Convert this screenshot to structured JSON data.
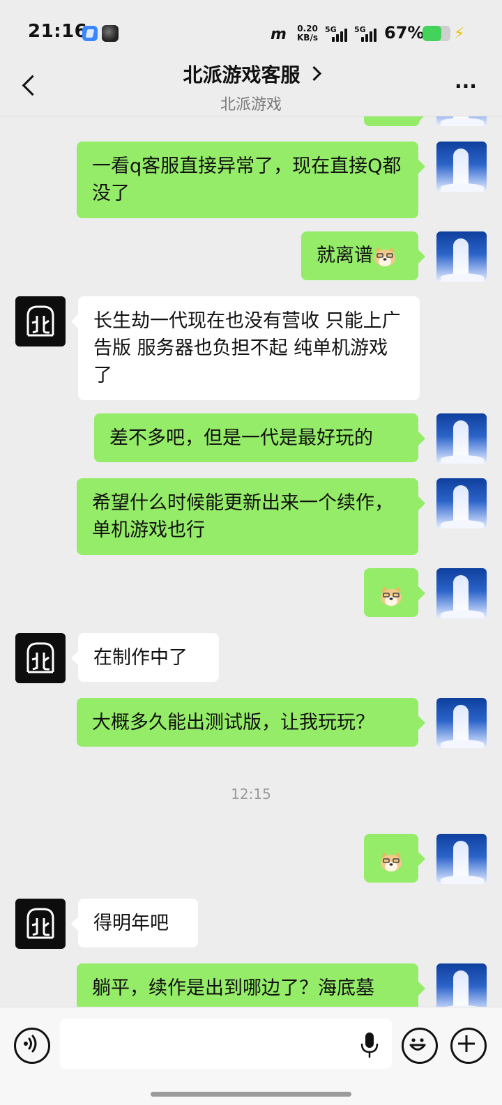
{
  "status_bar": {
    "time": "21:16",
    "net_speed_value": "0.20",
    "net_speed_unit": "KB/s",
    "sim1": "5G",
    "sim2": "5G",
    "battery_percent": "67%",
    "battery_level": 0.67,
    "colors": {
      "battery_fill": "#43d35a",
      "charging_bolt": "#f2c200"
    }
  },
  "header": {
    "title": "北派游戏客服",
    "subtitle": "北派游戏",
    "more_label": "···"
  },
  "chat": {
    "messages": [
      {
        "sender": "me",
        "text": "一看q客服直接异常了，现在直接Q都没了"
      },
      {
        "sender": "me",
        "text": "就离谱",
        "sticker": "doge-sticker"
      },
      {
        "sender": "them",
        "text": "长生劫一代现在也没有营收 只能上广告版 服务器也负担不起 纯单机游戏了"
      },
      {
        "sender": "me",
        "text": "差不多吧，但是一代是最好玩的"
      },
      {
        "sender": "me",
        "text": "希望什么时候能更新出来一个续作，单机游戏也行"
      },
      {
        "sender": "me",
        "text": "",
        "sticker": "doge-sticker"
      },
      {
        "sender": "them",
        "text": "在制作中了"
      },
      {
        "sender": "me",
        "text": "大概多久能出测试版，让我玩玩？"
      },
      {
        "sender": "me",
        "text": "",
        "sticker": "doge-sticker"
      },
      {
        "sender": "them",
        "text": "得明年吧"
      },
      {
        "sender": "me",
        "text": "躺平，续作是出到哪边了？海底墓"
      }
    ],
    "timestamp": "12:15"
  },
  "input_bar": {
    "placeholder": "",
    "icons": [
      "voice-icon",
      "microphone-icon",
      "emoji-icon",
      "plus-icon"
    ]
  },
  "colors": {
    "my_bubble": "#95ec69",
    "their_bubble": "#ffffff",
    "chat_background": "#ededed",
    "my_avatar": "#2b63c8",
    "their_avatar": "#0d0d0d"
  }
}
